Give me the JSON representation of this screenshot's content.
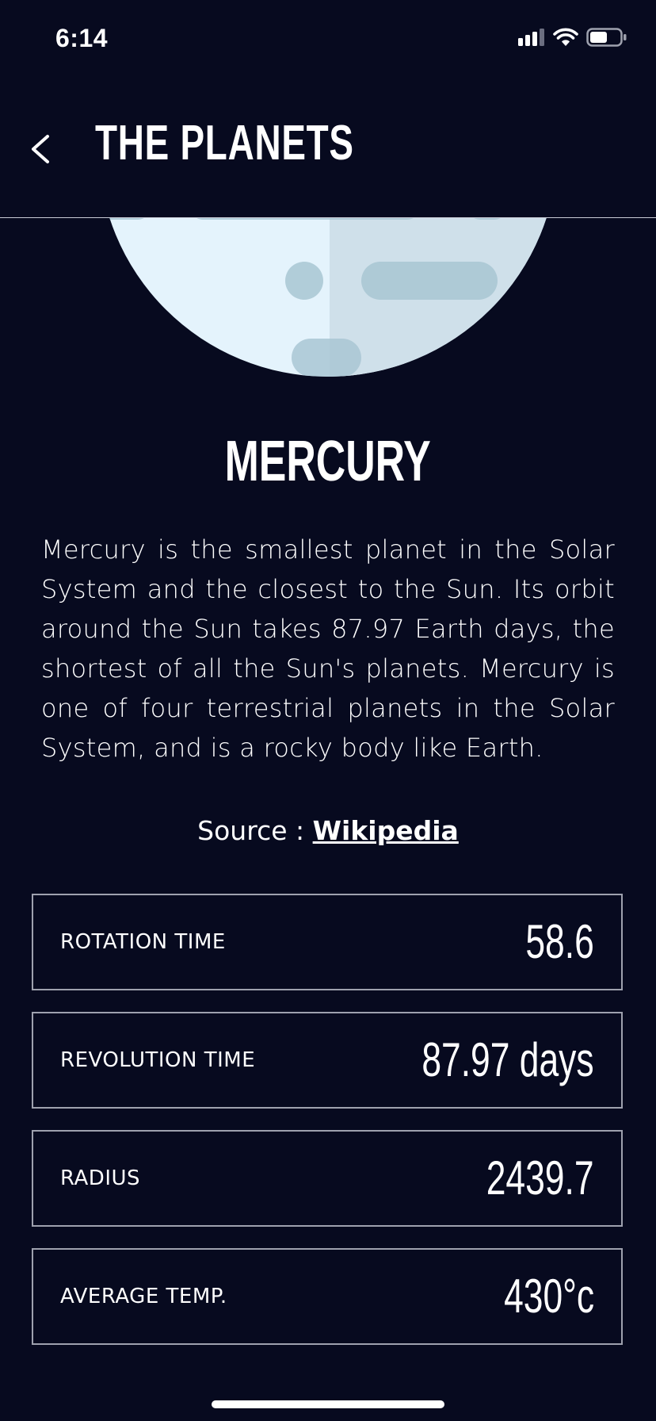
{
  "status_bar": {
    "time": "6:14",
    "icons": [
      "cellular-signal-icon",
      "wifi-icon",
      "battery-icon"
    ]
  },
  "header": {
    "back_icon": "chevron-left-icon",
    "title": "THE PLANETS"
  },
  "planet": {
    "illustration": "mercury-illustration",
    "name": "MERCURY",
    "description": "Mercury is the smallest planet in the Solar System and the closest to the Sun. Its orbit around the Sun takes 87.97 Earth days, the shortest of all the Sun's planets. Mercury is one of four terrestrial planets in the Solar System, and is a rocky body like Earth."
  },
  "source": {
    "prefix": "Source : ",
    "link_label": "Wikipedia"
  },
  "stats": [
    {
      "label": "ROTATION TIME",
      "value": "58.6"
    },
    {
      "label": "REVOLUTION TIME",
      "value": "87.97 days"
    },
    {
      "label": "RADIUS",
      "value": "2439.7"
    },
    {
      "label": "AVERAGE TEMP.",
      "value": "430°c"
    }
  ],
  "colors": {
    "background": "#070A1F",
    "text": "#FFFFFF",
    "border": "#9EA1AE",
    "planet_light": "#E4F3FC",
    "planet_shade": "#CFE0EA",
    "crater": "#A9C6D3"
  }
}
